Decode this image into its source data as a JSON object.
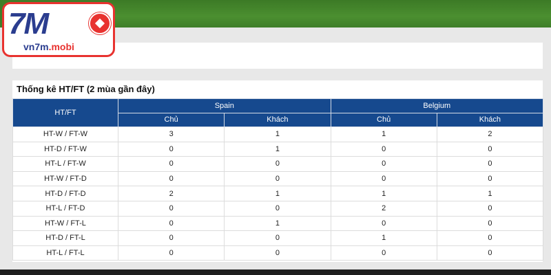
{
  "logo": {
    "mark": "7M",
    "domain_main": "vn7m",
    "domain_accent": ".mobi"
  },
  "stats": {
    "title": "Thống kê HT/FT (2 mùa gần đây)",
    "first_col_header": "HT/FT",
    "teams": [
      {
        "name": "Spain",
        "columns": [
          "Chủ",
          "Khách"
        ]
      },
      {
        "name": "Belgium",
        "columns": [
          "Chủ",
          "Khách"
        ]
      }
    ],
    "rows": [
      {
        "label": "HT-W / FT-W",
        "values": [
          "3",
          "1",
          "1",
          "2"
        ]
      },
      {
        "label": "HT-D / FT-W",
        "values": [
          "0",
          "1",
          "0",
          "0"
        ]
      },
      {
        "label": "HT-L / FT-W",
        "values": [
          "0",
          "0",
          "0",
          "0"
        ]
      },
      {
        "label": "HT-W / FT-D",
        "values": [
          "0",
          "0",
          "0",
          "0"
        ]
      },
      {
        "label": "HT-D / FT-D",
        "values": [
          "2",
          "1",
          "1",
          "1"
        ]
      },
      {
        "label": "HT-L / FT-D",
        "values": [
          "0",
          "0",
          "2",
          "0"
        ]
      },
      {
        "label": "HT-W / FT-L",
        "values": [
          "0",
          "1",
          "0",
          "0"
        ]
      },
      {
        "label": "HT-D / FT-L",
        "values": [
          "0",
          "0",
          "1",
          "0"
        ]
      },
      {
        "label": "HT-L / FT-L",
        "values": [
          "0",
          "0",
          "0",
          "0"
        ]
      }
    ]
  },
  "colors": {
    "header_bg": "#16498e",
    "logo_blue": "#2b3d8f",
    "logo_red": "#e8322f",
    "banner_green": "#4b8f30"
  }
}
